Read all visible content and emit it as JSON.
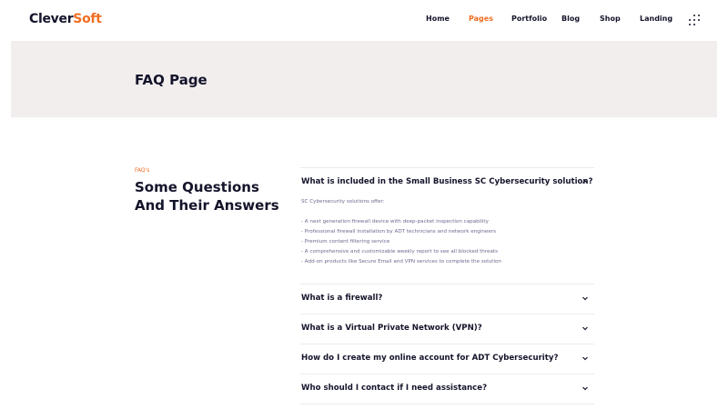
{
  "header": {
    "logo_part1": "Clever",
    "logo_part2": "Soft",
    "nav": [
      "Home",
      "Pages",
      "Portfolio",
      "Blog",
      "Shop",
      "Landing"
    ],
    "active_nav": "Pages",
    "menu_icon": "grid-dots-icon"
  },
  "hero": {
    "title": "FAQ Page"
  },
  "faq": {
    "eyebrow": "FAQ's",
    "heading_line1": "Some Questions",
    "heading_line2": "And Their Answers",
    "items": [
      {
        "question": "What is included in the Small Business SC Cybersecurity solution?",
        "expanded": true,
        "chevron": "chevron-up-icon",
        "answer_intro": "SC Cybersecurity solutions offer:",
        "answer_bullets": [
          "- A next generation firewall device with deep-packet inspection capability",
          "- Professional firewall installation by ADT technicians and network engineers",
          "- Premium content filtering service",
          "- A comprehensive and customizable weekly report to see all blocked threats",
          "- Add-on products like Secure Email and VPN services to complete the solution"
        ]
      },
      {
        "question": "What is a firewall?",
        "expanded": false,
        "chevron": "chevron-down-icon"
      },
      {
        "question": "What is a Virtual Private Network (VPN)?",
        "expanded": false,
        "chevron": "chevron-down-icon"
      },
      {
        "question": "How do I create my online account for ADT Cybersecurity?",
        "expanded": false,
        "chevron": "chevron-down-icon"
      },
      {
        "question": "Who should I contact if I need assistance?",
        "expanded": false,
        "chevron": "chevron-down-icon"
      }
    ]
  },
  "colors": {
    "accent": "#f26d21",
    "text": "#14142b",
    "hero_bg": "#f3eeee",
    "muted": "#6e6a8f"
  }
}
